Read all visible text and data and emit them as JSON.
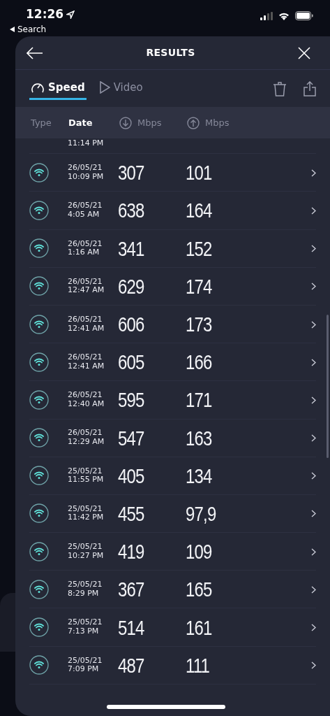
{
  "status_bar": {
    "time": "12:26",
    "back_label": "Search"
  },
  "header": {
    "title": "RESULTS"
  },
  "tabs": [
    {
      "label": "Speed",
      "selected": true,
      "kind": "speed"
    },
    {
      "label": "Video",
      "selected": false,
      "kind": "video"
    }
  ],
  "columns": [
    "Type",
    "Date",
    "Mbps",
    "Mbps"
  ],
  "partial_row": {
    "time": "11:14 PM"
  },
  "rows": [
    {
      "date": "26/05/21",
      "time": "10:09 PM",
      "download": "307",
      "upload": "101"
    },
    {
      "date": "26/05/21",
      "time": "4:05 AM",
      "download": "638",
      "upload": "164"
    },
    {
      "date": "26/05/21",
      "time": "1:16 AM",
      "download": "341",
      "upload": "152"
    },
    {
      "date": "26/05/21",
      "time": "12:47 AM",
      "download": "629",
      "upload": "174"
    },
    {
      "date": "26/05/21",
      "time": "12:41 AM",
      "download": "606",
      "upload": "173"
    },
    {
      "date": "26/05/21",
      "time": "12:41 AM",
      "download": "605",
      "upload": "166"
    },
    {
      "date": "26/05/21",
      "time": "12:40 AM",
      "download": "595",
      "upload": "171"
    },
    {
      "date": "26/05/21",
      "time": "12:29 AM",
      "download": "547",
      "upload": "163"
    },
    {
      "date": "25/05/21",
      "time": "11:55 PM",
      "download": "405",
      "upload": "134"
    },
    {
      "date": "25/05/21",
      "time": "11:42 PM",
      "download": "455",
      "upload": "97,9"
    },
    {
      "date": "25/05/21",
      "time": "10:27 PM",
      "download": "419",
      "upload": "109"
    },
    {
      "date": "25/05/21",
      "time": "8:29 PM",
      "download": "367",
      "upload": "165"
    },
    {
      "date": "25/05/21",
      "time": "7:13 PM",
      "download": "514",
      "upload": "161"
    },
    {
      "date": "25/05/21",
      "time": "7:09 PM",
      "download": "487",
      "upload": "111"
    }
  ]
}
